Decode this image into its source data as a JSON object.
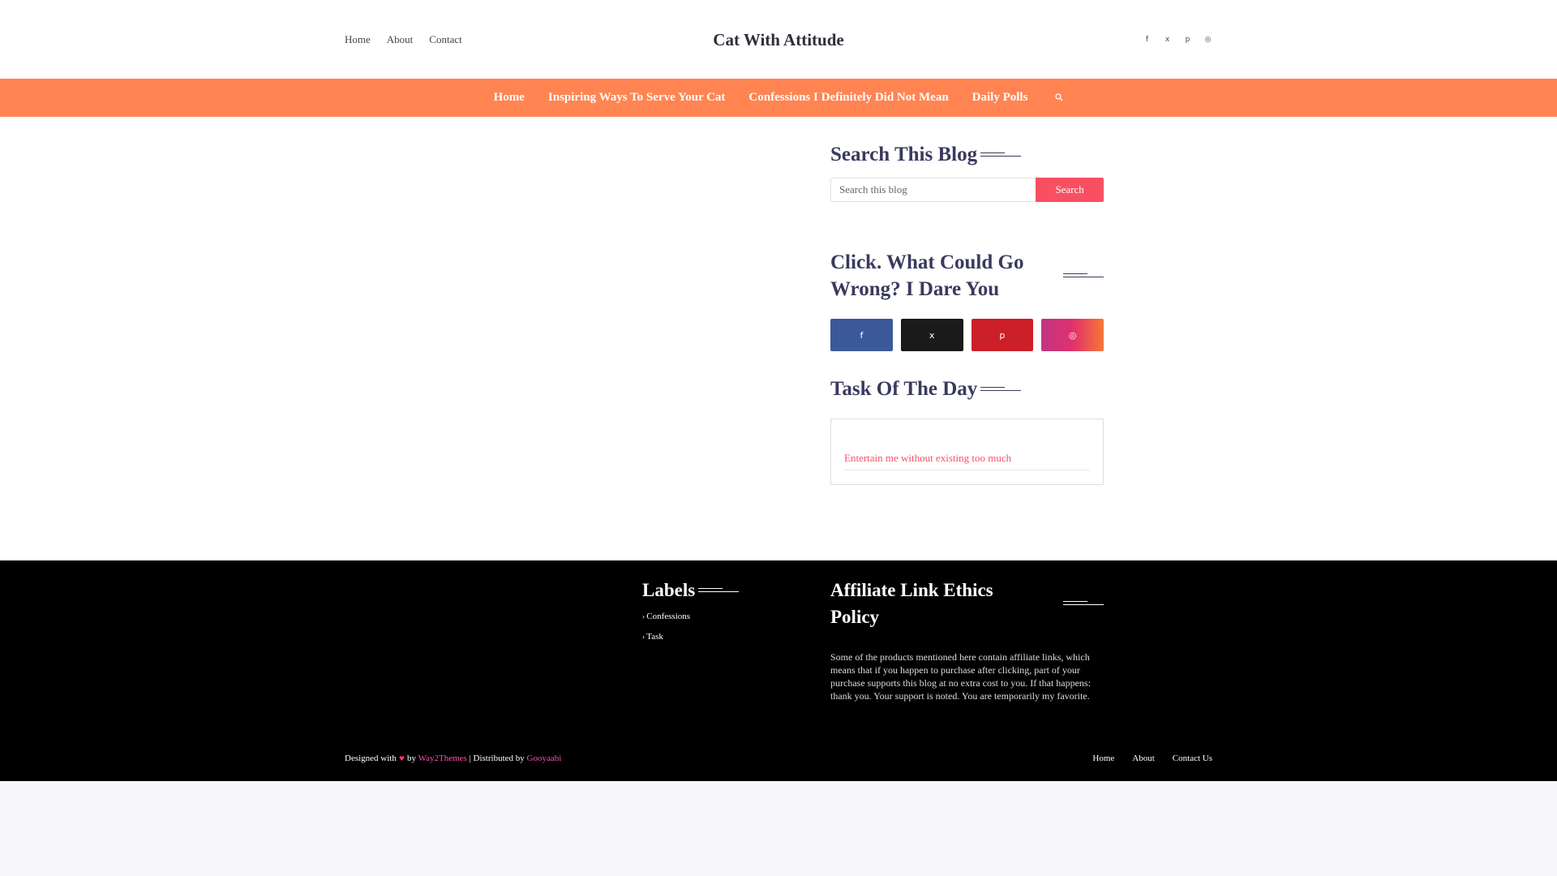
{
  "header": {
    "links": [
      "Home",
      "About",
      "Contact"
    ],
    "site_title": "Cat With Attitude",
    "social_icons": [
      "facebook-icon",
      "x-icon",
      "pinterest-icon",
      "instagram-icon"
    ]
  },
  "nav": {
    "items": [
      "Home",
      "Inspiring Ways To Serve Your Cat",
      "Confessions I Definitely Did Not Mean",
      "Daily Polls"
    ],
    "search_icon": "search-icon"
  },
  "sidebar": {
    "search": {
      "title": "Search This Blog",
      "placeholder": "Search this blog",
      "button": "Search"
    },
    "social": {
      "title": "Click. What Could Go Wrong? I Dare You",
      "buttons": [
        {
          "icon": "facebook-icon",
          "color": "#3b5998"
        },
        {
          "icon": "x-icon",
          "color": "#1a1a1a"
        },
        {
          "icon": "pinterest-icon",
          "color": "#cb2027"
        },
        {
          "icon": "instagram-icon",
          "color": "#c13584"
        }
      ]
    },
    "task": {
      "title": "Task Of The Day",
      "link": "Entertain me without existing too much"
    }
  },
  "footer": {
    "labels_title": "Labels",
    "labels": [
      "Confessions",
      "Task"
    ],
    "policy_title": "Affiliate Link Ethics Policy",
    "policy_text": "Some of the products mentioned here contain affiliate links, which means that if you happen to purchase after clicking, part of your purchase supports this blog at no extra cost to you. If that happens: thank you. Your support is noted. You are temporarily my favorite.",
    "credits": {
      "designed_with": "Designed with",
      "by": "by",
      "theme": "Way2Themes",
      "distributed": "| Distributed by",
      "distributor": "Gooyaabi"
    },
    "links": [
      "Home",
      "About",
      "Contact Us"
    ]
  },
  "colors": {
    "accent": "#ff8452",
    "button": "#f94f63",
    "title": "#3a3a5e"
  }
}
